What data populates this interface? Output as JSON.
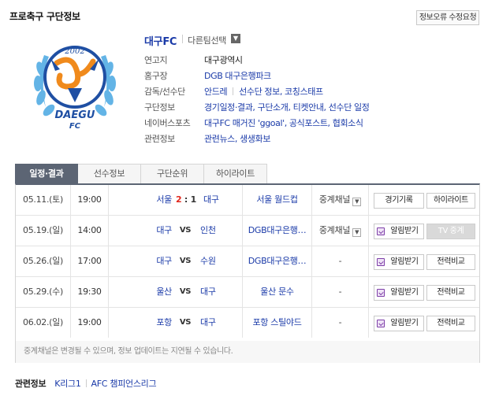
{
  "header": {
    "title": "프로축구 구단정보",
    "report_button": "정보오류 수정요청"
  },
  "logo": {
    "year": "2002",
    "text_top": "DAEGU",
    "text_bottom": "FC",
    "colors": {
      "navy": "#1f4fa3",
      "orange": "#f08a1c",
      "sky": "#63b4e6"
    }
  },
  "team": {
    "name": "대구FC",
    "other_team": "다른팀선택",
    "info": [
      {
        "label": "연고지",
        "values": [
          "대구광역시"
        ],
        "link": false
      },
      {
        "label": "홈구장",
        "values": [
          "DGB 대구은행파크"
        ],
        "link": true
      },
      {
        "label": "감독/선수단",
        "values": [
          "안드레",
          "선수단 정보, 코칭스태프"
        ],
        "link": true
      },
      {
        "label": "구단정보",
        "values": [
          "경기일정·결과, 구단소개, 티켓안내, 선수단 일정"
        ],
        "link": true
      },
      {
        "label": "네이버스포츠",
        "values": [
          "대구FC 매거진 'ggoal', 공식포스트, 협회소식"
        ],
        "link": true
      },
      {
        "label": "관련정보",
        "values": [
          "관련뉴스, 생생화보"
        ],
        "link": true
      }
    ]
  },
  "tabs": [
    "일정·결과",
    "선수정보",
    "구단순위",
    "하이라이트"
  ],
  "schedule": {
    "rows": [
      {
        "date": "05.11.(토)",
        "time": "19:00",
        "home": "서울",
        "away": "대구",
        "score_home": "2",
        "score_away": "1",
        "venue": "서울 월드컵",
        "broadcast": "중계채널",
        "bcast_dropdown": true,
        "btn1": "경기기록",
        "btn2": "하이라이트",
        "alarm": false,
        "btn2_disabled": false
      },
      {
        "date": "05.19.(일)",
        "time": "14:00",
        "home": "대구",
        "away": "인천",
        "vs": "VS",
        "venue": "DGB대구은행…",
        "broadcast": "중계채널",
        "bcast_dropdown": true,
        "btn1": "알림받기",
        "btn2": "TV 중계",
        "alarm": true,
        "btn2_disabled": true
      },
      {
        "date": "05.26.(일)",
        "time": "17:00",
        "home": "대구",
        "away": "수원",
        "vs": "VS",
        "venue": "DGB대구은행…",
        "broadcast": "-",
        "bcast_dropdown": false,
        "btn1": "알림받기",
        "btn2": "전력비교",
        "alarm": true,
        "btn2_disabled": false
      },
      {
        "date": "05.29.(수)",
        "time": "19:30",
        "home": "울산",
        "away": "대구",
        "vs": "VS",
        "venue": "울산 문수",
        "broadcast": "-",
        "bcast_dropdown": false,
        "btn1": "알림받기",
        "btn2": "전력비교",
        "alarm": true,
        "btn2_disabled": false
      },
      {
        "date": "06.02.(일)",
        "time": "19:00",
        "home": "포항",
        "away": "대구",
        "vs": "VS",
        "venue": "포항 스틸야드",
        "broadcast": "-",
        "bcast_dropdown": false,
        "btn1": "알림받기",
        "btn2": "전력비교",
        "alarm": true,
        "btn2_disabled": false
      }
    ],
    "note": "중계채널은 변경될 수 있으며, 정보 업데이트는 지연될 수 있습니다."
  },
  "related": {
    "label": "관련정보",
    "links": [
      "K리그1",
      "AFC 챔피언스리그"
    ]
  }
}
